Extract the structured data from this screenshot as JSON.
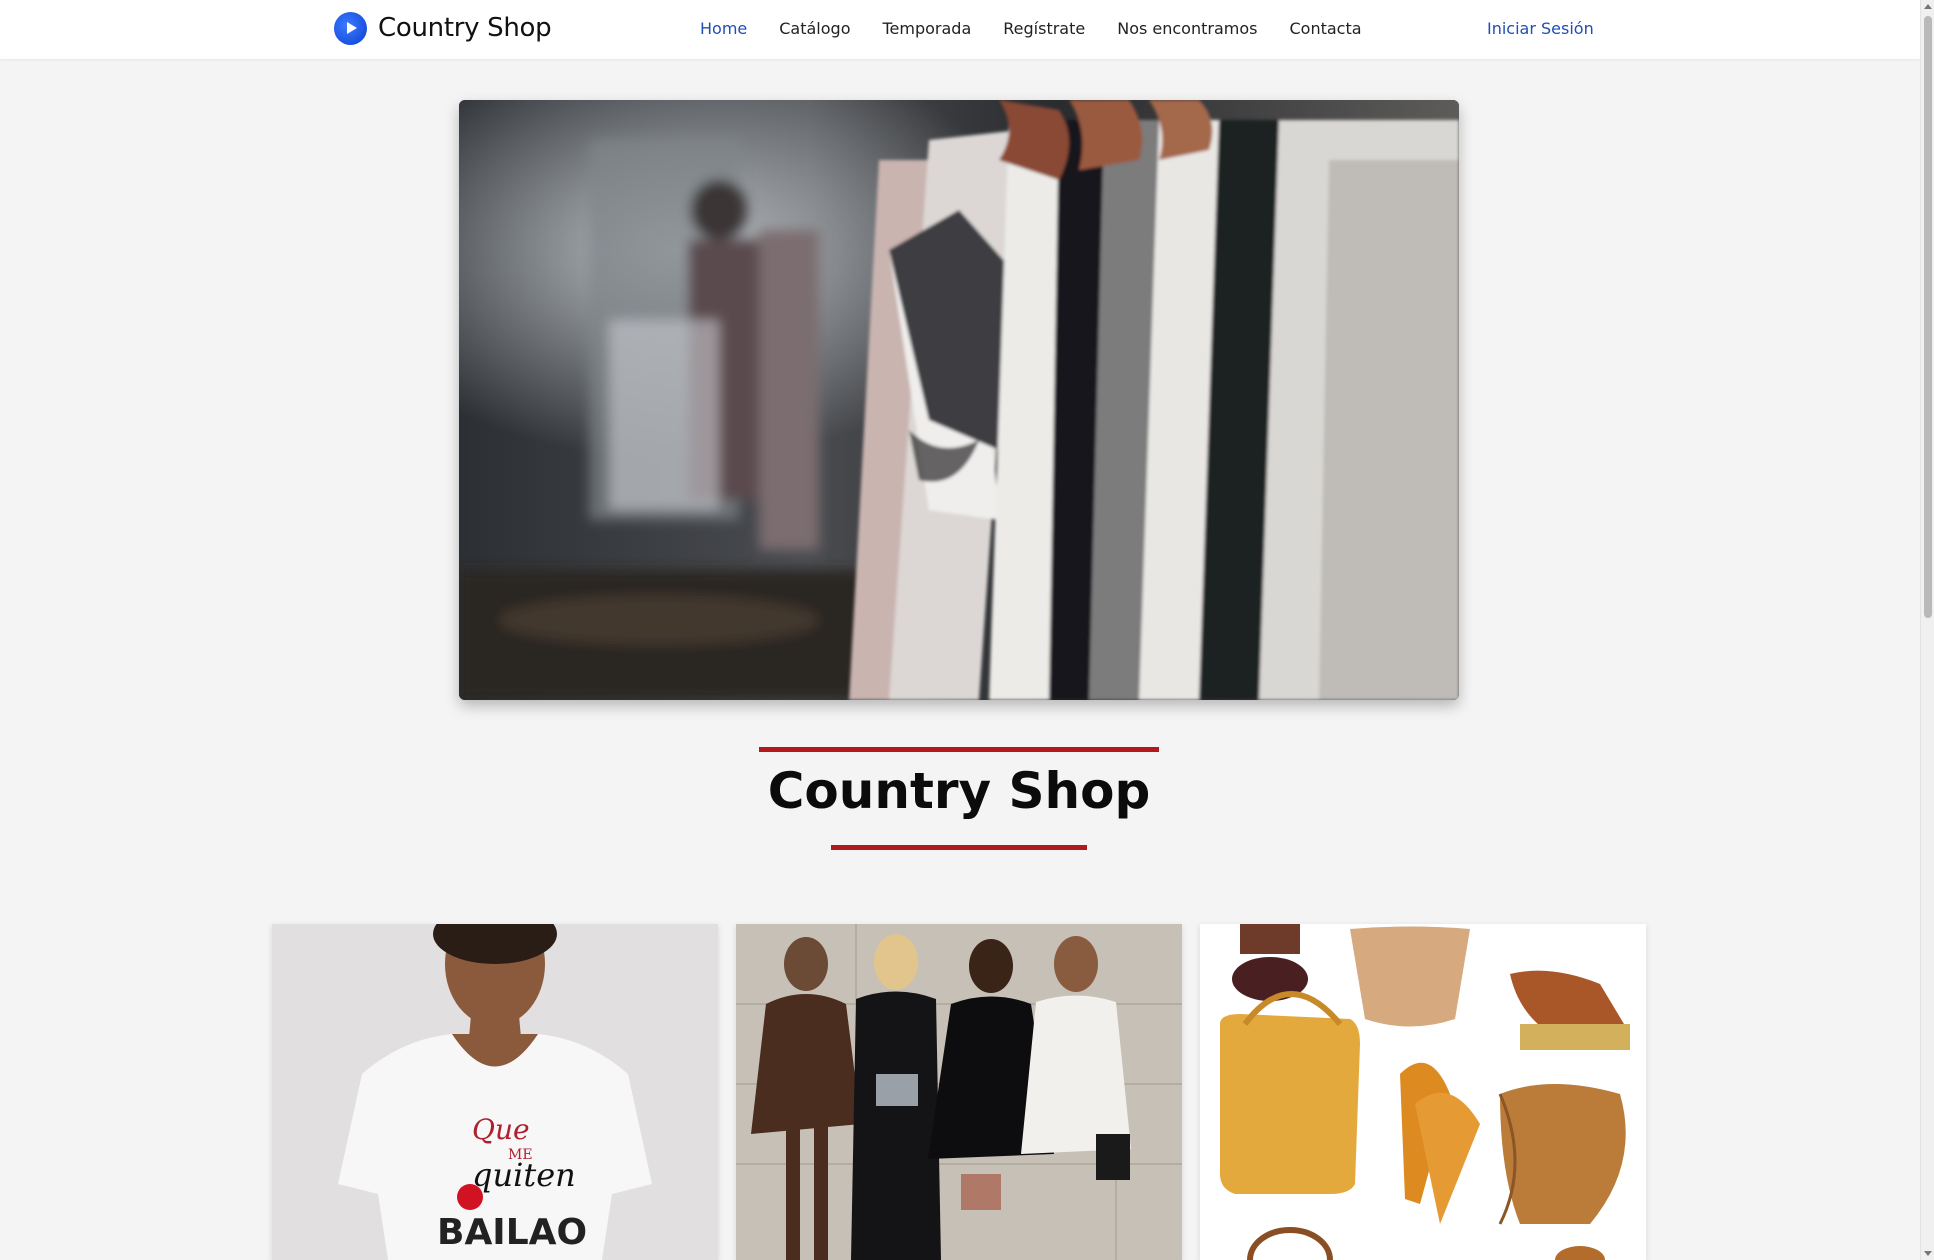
{
  "navbar": {
    "brand_name": "Country Shop",
    "links": [
      {
        "label": "Home",
        "active": true
      },
      {
        "label": "Catálogo",
        "active": false
      },
      {
        "label": "Temporada",
        "active": false
      },
      {
        "label": "Regístrate",
        "active": false
      },
      {
        "label": "Nos encontramos",
        "active": false
      },
      {
        "label": "Contacta",
        "active": false
      }
    ],
    "login_label": "Iniciar Sesión"
  },
  "main": {
    "title": "Country Shop"
  },
  "colors": {
    "accent_blue": "#1f4fb5",
    "title_rule_red": "#b3181d",
    "page_background": "#f4f4f4"
  },
  "icons": {
    "brand_logo": "play-circle-icon"
  }
}
